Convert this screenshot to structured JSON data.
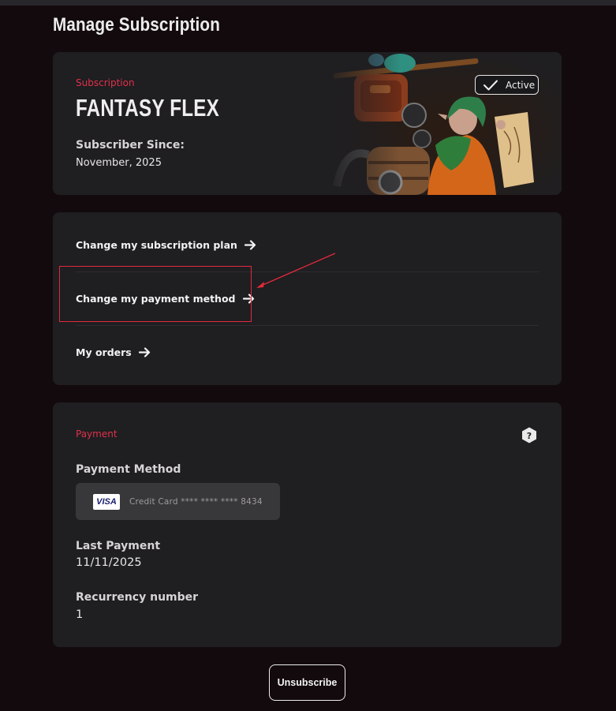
{
  "page": {
    "title": "Manage Subscription"
  },
  "subscription": {
    "label": "Subscription",
    "plan_name": "FANTASY FLEX",
    "since_label": "Subscriber Since:",
    "since_value": "November, 2025",
    "status": "Active",
    "image": "fantasy-adventurer-miniature"
  },
  "links": [
    {
      "label": "Change my subscription plan",
      "icon": "arrow-right-icon"
    },
    {
      "label": "Change my payment method",
      "icon": "arrow-right-icon"
    },
    {
      "label": "My orders",
      "icon": "arrow-right-icon"
    }
  ],
  "payment": {
    "label": "Payment",
    "method_label": "Payment Method",
    "card_brand": "VISA",
    "card_text": "Credit Card **** **** **** 8434",
    "last_payment_label": "Last Payment",
    "last_payment_value": "11/11/2025",
    "recurrency_label": "Recurrency number",
    "recurrency_value": "1"
  },
  "actions": {
    "unsubscribe": "Unsubscribe"
  },
  "colors": {
    "background": "#130a0d",
    "card": "#1f1e21",
    "accent_red": "#e0314a",
    "highlight_red": "#e12a3a"
  }
}
